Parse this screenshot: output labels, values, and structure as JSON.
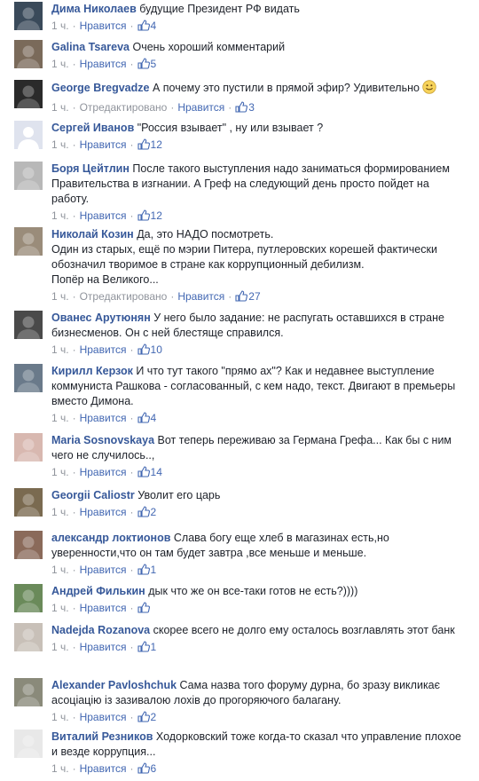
{
  "colors": {
    "link": "#365899",
    "meta": "#90949c",
    "like": "#4267b2",
    "text": "#1d2129"
  },
  "labels": {
    "like": "Нравится",
    "edited": "Отредактировано"
  },
  "comments": [
    {
      "name": "Дима Николаев",
      "text": "будущие Президент РФ видать",
      "time": "1 ч.",
      "edited": false,
      "likes": "4",
      "avatar_color": "#3a4a5a"
    },
    {
      "name": "Galina Tsareva",
      "text": "Очень хороший комментарий",
      "time": "1 ч.",
      "edited": false,
      "likes": "5",
      "avatar_color": "#7a6a5a"
    },
    {
      "name": "George Bregvadze",
      "text": "А почему это пустили в прямой эфир? Удивительно",
      "time": "1 ч.",
      "edited": true,
      "likes": "3",
      "avatar_color": "#2a2a2a",
      "emoji": "smiley-icon"
    },
    {
      "name": "Сергей Иванов",
      "text": "\"Россия взывает\" , ну или взывает ?",
      "time": "1 ч.",
      "edited": false,
      "likes": "12",
      "avatar_color": "#c9d0dd",
      "placeholder": true
    },
    {
      "name": "Боря Цейтлин",
      "text": "После такого выступления надо заниматься формированием Правительства в изгнании. А Греф на следующий день просто пойдет на работу.",
      "time": "1 ч.",
      "edited": false,
      "likes": "12",
      "avatar_color": "#b8b8b8"
    },
    {
      "name": "Николай Козин",
      "text": "Да, это НАДО посмотреть.\nОдин из старых, ещё по мэрии Питера, путлеровских корешей фактически обозначил творимое в стране как коррупционный дебилизм.\nПопёр на Великого...",
      "time": "1 ч.",
      "edited": true,
      "likes": "27",
      "avatar_color": "#9a8c7a"
    },
    {
      "name": "Ованес Арутюнян",
      "text": "У него было задание: не распугать оставшихся в стране бизнесменов. Он с ней блестяще справился.",
      "time": "1 ч.",
      "edited": false,
      "likes": "10",
      "avatar_color": "#4a4a4a"
    },
    {
      "name": "Кирилл Керзок",
      "text": "И что тут такого \"прямо ах\"? Как и недавнее выступление коммуниста Рашкова - согласованный, с кем надо, текст. Двигают в премьеры вместо Димона.",
      "time": "1 ч.",
      "edited": false,
      "likes": "4",
      "avatar_color": "#6a7a8a"
    },
    {
      "name": "Maria Sosnovskaya",
      "text": "Вот теперь переживаю за Германа Грефа... Как бы с ним чего не случилось..,",
      "time": "1 ч.",
      "edited": false,
      "likes": "14",
      "avatar_color": "#d8b8b0"
    },
    {
      "name": "Georgii Caliostr",
      "text": "Уволит его царь",
      "time": "1 ч.",
      "edited": false,
      "likes": "2",
      "avatar_color": "#7a6a50"
    },
    {
      "name": "александр локтионов",
      "text": "Слава богу еще хлеб в магазинах есть,но уверенности,что он там будет завтра ,все меньше и меньше.",
      "time": "1 ч.",
      "edited": false,
      "likes": "1",
      "avatar_color": "#8a6a5a"
    },
    {
      "name": "Андрей Филькин",
      "text": "дык что же он все-таки готов не есть?))))",
      "time": "1 ч.",
      "edited": false,
      "likes": "",
      "avatar_color": "#6a8a5a"
    },
    {
      "name": "Nadejda Rozanova",
      "text": "скорее всего не долго ему осталось возглавлять этот банк",
      "time": "1 ч.",
      "edited": false,
      "likes": "1",
      "avatar_color": "#c8c0b8"
    },
    {
      "name": "Alexander Pavloshchuk",
      "text": "Сама назва того форуму дурна, бо зразу викликає асоціацію із зазивалою лохів до прогоряючого балагану.",
      "time": "1 ч.",
      "edited": false,
      "likes": "2",
      "avatar_color": "#8a8a7a"
    },
    {
      "name": "Виталий Резников",
      "text": "Ходорковский тоже когда-то сказал что управление плохое и везде коррупция...",
      "time": "1 ч.",
      "edited": false,
      "likes": "6",
      "avatar_color": "#e8e8e8"
    }
  ]
}
